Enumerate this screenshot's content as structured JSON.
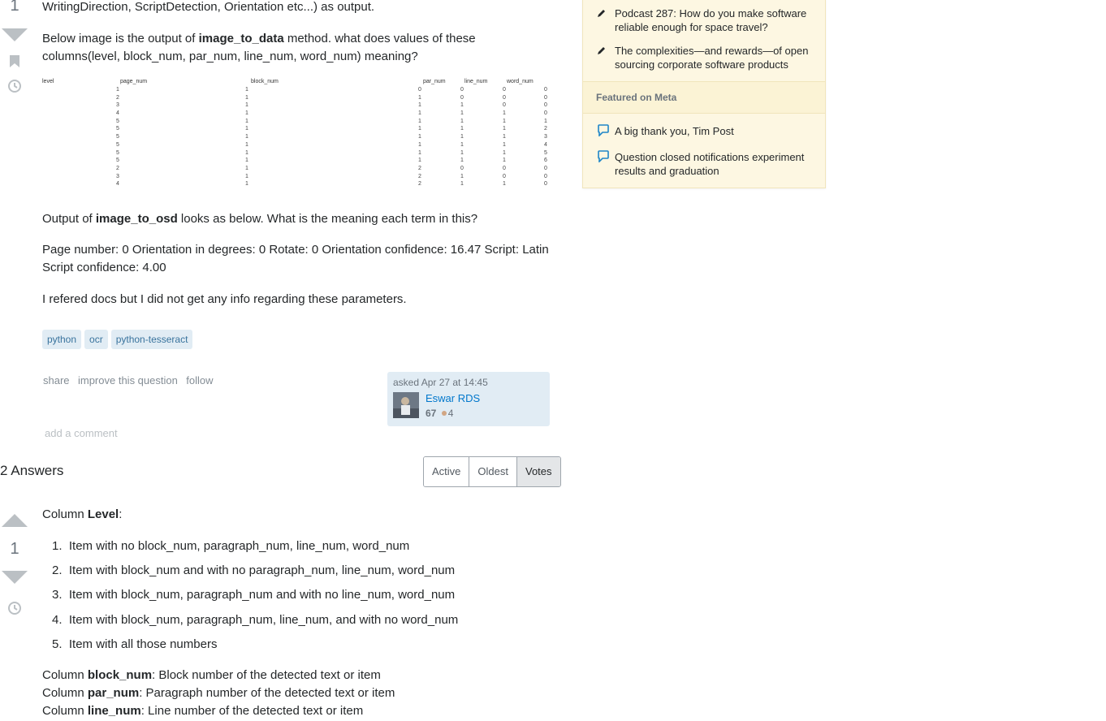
{
  "question": {
    "vote_count": "1",
    "top_line": "WritingDirection, ScriptDetection, Orientation etc...) as output.",
    "p1": {
      "pre": "Below image is the output of ",
      "bold": "image_to_data",
      "post": " method. what does values of these columns(level, block_num, par_num, line_num, word_num) meaning?"
    },
    "data_table": {
      "headers": [
        "level",
        "page_num",
        "block_num",
        "par_num",
        "line_num",
        "word_num"
      ],
      "page_num": [
        "1",
        "2",
        "3",
        "4",
        "5",
        "5",
        "5",
        "5",
        "5",
        "5",
        "2",
        "3",
        "4"
      ],
      "block_num": [
        "1",
        "1",
        "1",
        "1",
        "1",
        "1",
        "1",
        "1",
        "1",
        "1",
        "1",
        "1",
        "1"
      ],
      "par_num": [
        "0",
        "1",
        "1",
        "1",
        "1",
        "1",
        "1",
        "1",
        "1",
        "1",
        "2",
        "2",
        "2"
      ],
      "line_num": [
        "0",
        "0",
        "1",
        "1",
        "1",
        "1",
        "1",
        "1",
        "1",
        "1",
        "0",
        "1",
        "1"
      ],
      "word_num": [
        "0",
        "0",
        "0",
        "1",
        "1",
        "1",
        "1",
        "1",
        "1",
        "1",
        "0",
        "0",
        "1"
      ],
      "word_num2": [
        "0",
        "0",
        "0",
        "0",
        "1",
        "2",
        "3",
        "4",
        "5",
        "6",
        "0",
        "0",
        "0"
      ]
    },
    "p2": {
      "pre": "Output of ",
      "bold": "image_to_osd",
      "post": " looks as below. What is the meaning each term in this?"
    },
    "p3": "Page number: 0 Orientation in degrees: 0 Rotate: 0 Orientation confidence: 16.47 Script: Latin Script confidence: 4.00",
    "p4": "I refered docs but I did not get any info regarding these parameters.",
    "tags": [
      "python",
      "ocr",
      "python-tesseract"
    ],
    "menu": {
      "share": "share",
      "improve": "improve this question",
      "follow": "follow"
    },
    "owner": {
      "asked": "asked Apr 27 at 14:45",
      "name": "Eswar RDS",
      "rep": "67",
      "badges": "4"
    },
    "add_comment": "add a comment"
  },
  "answers": {
    "header": "2 Answers",
    "sort": [
      "Active",
      "Oldest",
      "Votes"
    ],
    "active_sort": "Votes",
    "answer1": {
      "vote_count": "1",
      "level_line": {
        "pre": "Column ",
        "bold": "Level",
        "post": ":"
      },
      "list": [
        "Item with no block_num, paragraph_num, line_num, word_num",
        "Item with block_num and with no paragraph_num, line_num, word_num",
        "Item with block_num, paragraph_num and with no line_num, word_num",
        "Item with block_num, paragraph_num, line_num, and with no word_num",
        "Item with all those numbers"
      ],
      "columns": [
        {
          "pre": "Column ",
          "bold": "block_num",
          "post": ": Block number of the detected text or item"
        },
        {
          "pre": "Column ",
          "bold": "par_num",
          "post": ": Paragraph number of the detected text or item"
        },
        {
          "pre": "Column ",
          "bold": "line_num",
          "post": ": Line number of the detected text or item"
        }
      ]
    }
  },
  "sidebar": {
    "blog": [
      "Podcast 287: How do you make software reliable enough for space travel?",
      "The complexities—and rewards—of open sourcing corporate software products"
    ],
    "meta_header": "Featured on Meta",
    "meta": [
      "A big thank you, Tim Post",
      "Question closed notifications experiment results and graduation"
    ]
  },
  "colors": {
    "tag_bg": "#e1ecf4",
    "tag_fg": "#39739d",
    "sidebar_bg": "#fdf7e2",
    "link": "#0077cc"
  }
}
